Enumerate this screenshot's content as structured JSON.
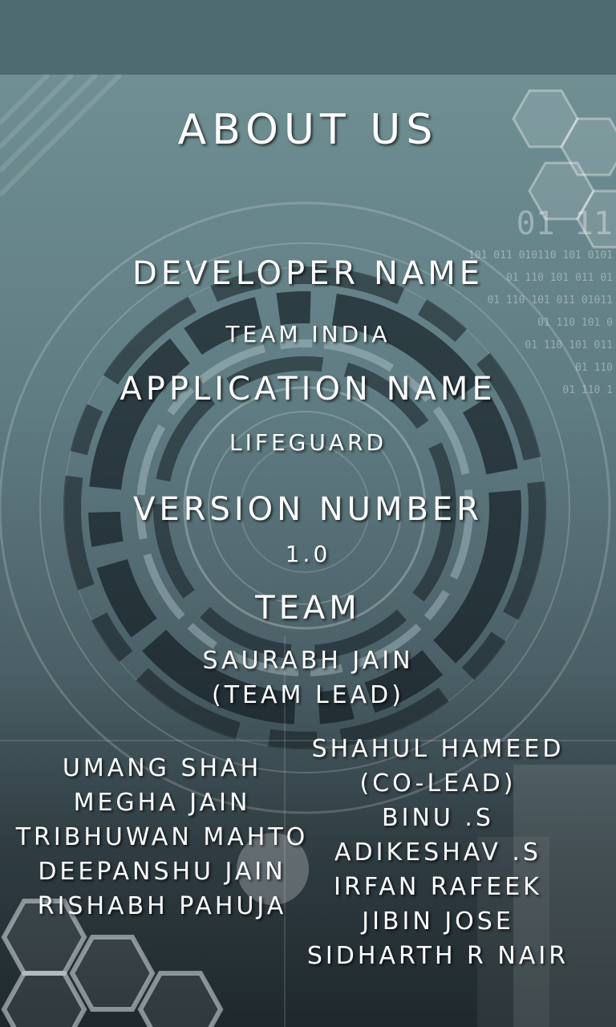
{
  "page": {
    "title": "ABOUT US"
  },
  "developer": {
    "label": "DEVELOPER NAME",
    "value": "TEAM INDIA"
  },
  "application": {
    "label": "APPLICATION NAME",
    "value": "LIFEGUARD"
  },
  "version": {
    "label": "VERSION NUMBER",
    "value": "1.0"
  },
  "team": {
    "label": "TEAM",
    "lead_name": "SAURABH JAIN",
    "lead_role": "(TEAM LEAD)",
    "left_members": [
      "UMANG SHAH",
      "MEGHA JAIN",
      "TRIBHUWAN MAHTO",
      "DEEPANSHU JAIN",
      "RISHABH PAHUJA"
    ],
    "right_members": [
      "SHAHUL HAMEED",
      "(CO-LEAD)",
      "BINU .S",
      "ADIKESHAV .S",
      "IRFAN RAFEEK",
      "JIBIN JOSE",
      "SIDHARTH R NAIR"
    ]
  },
  "background": {
    "binary_lines": [
      "01  11",
      "101 011 010110 101 0101",
      "01 110 101 011 01",
      "01 110 101 011 01011",
      "01 110 101 0",
      "01 110 101 011",
      "01 110",
      "01 110 1"
    ]
  }
}
